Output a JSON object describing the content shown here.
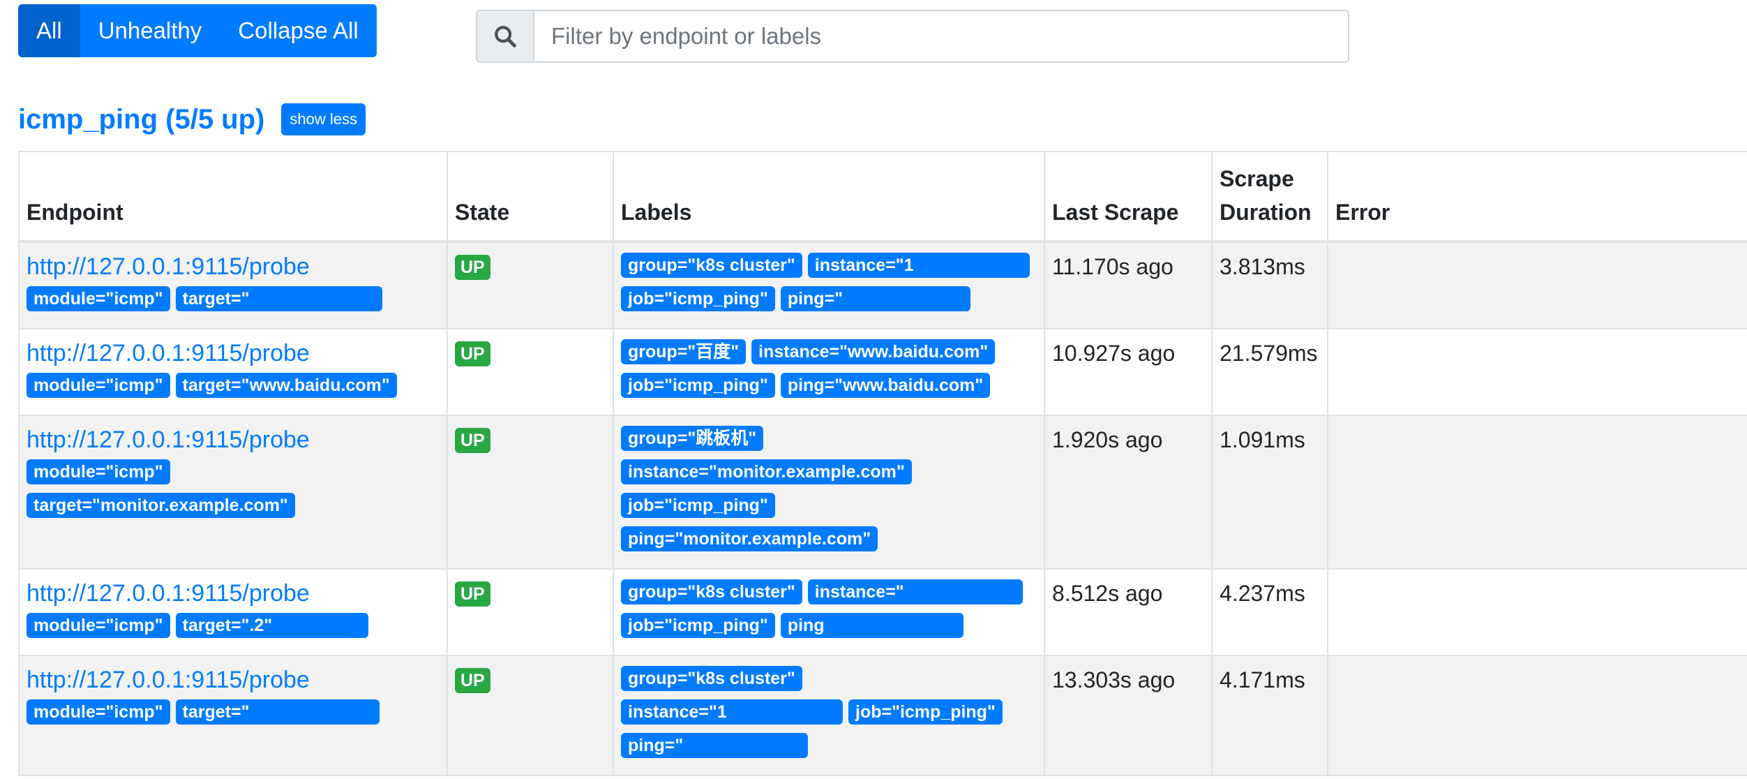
{
  "filters": {
    "all": "All",
    "unhealthy": "Unhealthy",
    "collapse": "Collapse All"
  },
  "search": {
    "placeholder": "Filter by endpoint or labels",
    "icon": "search-icon"
  },
  "pool": {
    "title": "icmp_ping (5/5 up)",
    "toggle_label": "show less"
  },
  "columns": {
    "endpoint": "Endpoint",
    "state": "State",
    "labels": "Labels",
    "last_scrape": "Last Scrape",
    "scrape_duration": "Scrape Duration",
    "error": "Error"
  },
  "rows": [
    {
      "endpoint": "http://127.0.0.1:9115/probe",
      "endpoint_labels": [
        "module=\"icmp\"",
        "target=\""
      ],
      "state": "UP",
      "labels": [
        "group=\"k8s cluster\"",
        "instance=\"1",
        "job=\"icmp_ping\"",
        "ping=\""
      ],
      "last_scrape": "11.170s ago",
      "scrape_duration": "3.813ms",
      "error": ""
    },
    {
      "endpoint": "http://127.0.0.1:9115/probe",
      "endpoint_labels": [
        "module=\"icmp\"",
        "target=\"www.baidu.com\""
      ],
      "state": "UP",
      "labels": [
        "group=\"百度\"",
        "instance=\"www.baidu.com\"",
        "job=\"icmp_ping\"",
        "ping=\"www.baidu.com\""
      ],
      "last_scrape": "10.927s ago",
      "scrape_duration": "21.579ms",
      "error": ""
    },
    {
      "endpoint": "http://127.0.0.1:9115/probe",
      "endpoint_labels": [
        "module=\"icmp\"",
        "target=\"monitor.example.com\""
      ],
      "state": "UP",
      "labels": [
        "group=\"跳板机\"",
        "instance=\"monitor.example.com\"",
        "job=\"icmp_ping\"",
        "ping=\"monitor.example.com\""
      ],
      "last_scrape": "1.920s ago",
      "scrape_duration": "1.091ms",
      "error": ""
    },
    {
      "endpoint": "http://127.0.0.1:9115/probe",
      "endpoint_labels": [
        "module=\"icmp\"",
        "target=\".2\""
      ],
      "state": "UP",
      "labels": [
        "group=\"k8s cluster\"",
        "instance=\"",
        "job=\"icmp_ping\"",
        "ping"
      ],
      "last_scrape": "8.512s ago",
      "scrape_duration": "4.237ms",
      "error": ""
    },
    {
      "endpoint": "http://127.0.0.1:9115/probe",
      "endpoint_labels": [
        "module=\"icmp\"",
        "target=\""
      ],
      "state": "UP",
      "labels": [
        "group=\"k8s cluster\"",
        "instance=\"1",
        "job=\"icmp_ping\"",
        "ping=\""
      ],
      "last_scrape": "13.303s ago",
      "scrape_duration": "4.171ms",
      "error": ""
    }
  ],
  "colors": {
    "primary": "#007bff",
    "active": "#0062cc",
    "success": "#28a745",
    "striped": "#f2f2f2"
  }
}
